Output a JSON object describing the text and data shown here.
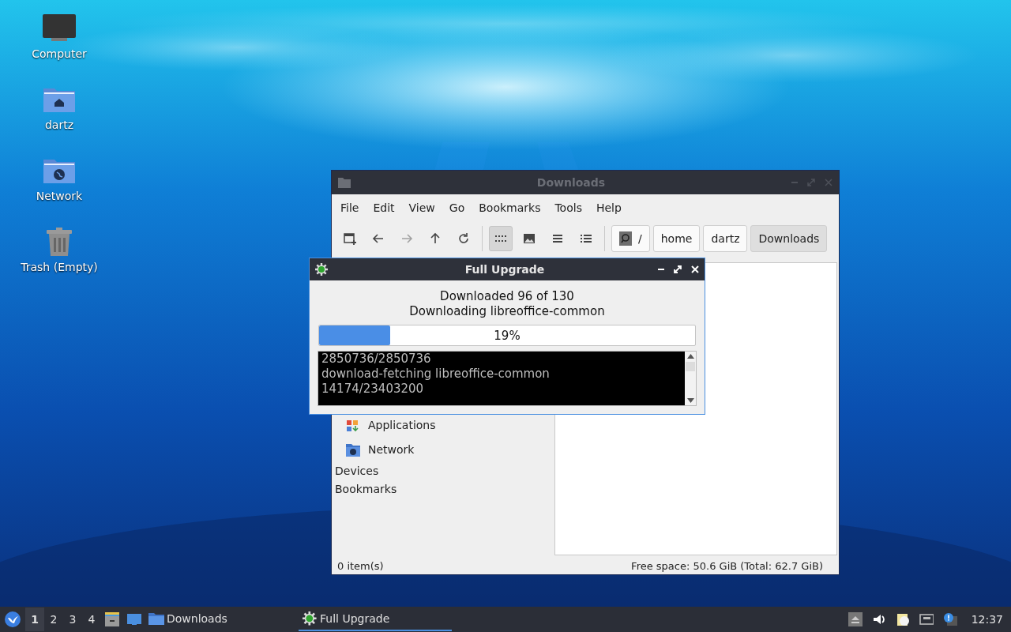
{
  "desktop": {
    "icons": [
      {
        "kind": "computer",
        "label": "Computer"
      },
      {
        "kind": "home-folder",
        "label": "dartz"
      },
      {
        "kind": "network-folder",
        "label": "Network"
      },
      {
        "kind": "trash",
        "label": "Trash (Empty)"
      }
    ]
  },
  "file_manager": {
    "title": "Downloads",
    "menu": [
      "File",
      "Edit",
      "View",
      "Go",
      "Bookmarks",
      "Tools",
      "Help"
    ],
    "toolbar": [
      {
        "kind": "new-tab",
        "disabled": false
      },
      {
        "kind": "back",
        "disabled": false
      },
      {
        "kind": "forward",
        "disabled": true
      },
      {
        "kind": "up",
        "disabled": false
      },
      {
        "kind": "reload",
        "disabled": false
      }
    ],
    "view_modes": [
      {
        "kind": "icon-view",
        "selected": true
      },
      {
        "kind": "thumbnail-view",
        "selected": false
      },
      {
        "kind": "compact-view",
        "selected": false
      },
      {
        "kind": "detail-view",
        "selected": false
      }
    ],
    "path": [
      {
        "label": "/",
        "root": true,
        "selected": false
      },
      {
        "label": "home",
        "root": false,
        "selected": false
      },
      {
        "label": "dartz",
        "root": false,
        "selected": false
      },
      {
        "label": "Downloads",
        "root": false,
        "selected": true
      }
    ],
    "sidebar": [
      {
        "kind": "applications",
        "label": "Applications"
      },
      {
        "kind": "network",
        "label": "Network"
      },
      {
        "kind": "section",
        "label": "Devices"
      },
      {
        "kind": "section",
        "label": "Bookmarks"
      }
    ],
    "status_bar": {
      "items": "0 item(s)",
      "free_space": "Free space: 50.6 GiB (Total: 62.7 GiB)"
    }
  },
  "dialog": {
    "title": "Full Upgrade",
    "lines": [
      "Downloaded 96 of 130",
      "Downloading libreoffice-common"
    ],
    "progress": {
      "level": 0.19,
      "reading": "19%"
    },
    "log": [
      "2850736/2850736",
      "download-fetching libreoffice-common",
      "14174/23403200"
    ]
  },
  "taskbar": {
    "workspaces": [
      {
        "label": "1",
        "selected": true
      },
      {
        "label": "2",
        "selected": false
      },
      {
        "label": "3",
        "selected": false
      },
      {
        "label": "4",
        "selected": false
      }
    ],
    "tasks": [
      {
        "kind": "folder",
        "label": "Downloads",
        "selected": false
      },
      {
        "kind": "gear",
        "label": "Full Upgrade",
        "selected": true
      }
    ],
    "clock": "12:37"
  }
}
